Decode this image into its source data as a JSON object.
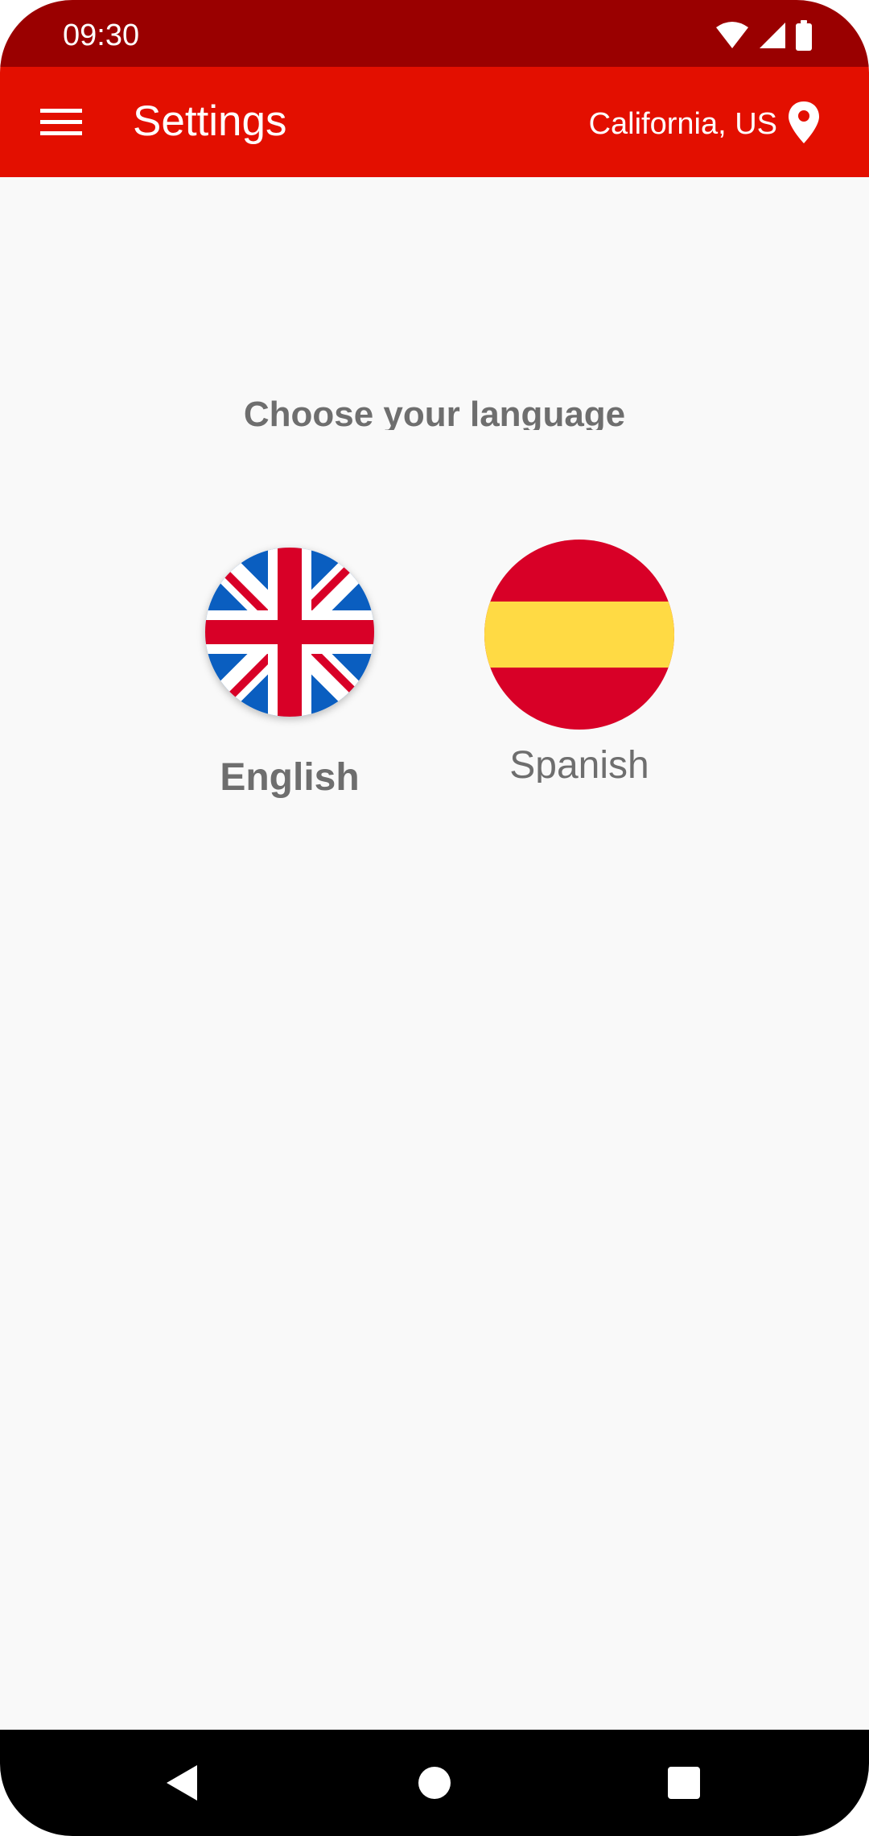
{
  "status_bar": {
    "time": "09:30",
    "icons": [
      "wifi-icon",
      "cell-signal-icon",
      "battery-icon"
    ]
  },
  "app_bar": {
    "menu_icon": "hamburger-menu-icon",
    "title": "Settings",
    "location_text": "California, US",
    "location_icon": "location-pin-icon"
  },
  "main": {
    "heading": "Choose your language",
    "languages": [
      {
        "label": "English",
        "flag": "uk-flag-icon",
        "selected": true
      },
      {
        "label": "Spanish",
        "flag": "spain-flag-icon",
        "selected": false
      }
    ]
  },
  "nav_bar": {
    "buttons": [
      "back-icon",
      "home-icon",
      "recents-icon"
    ]
  },
  "colors": {
    "status_bar": "#9a0000",
    "app_bar": "#e30f00",
    "background": "#f9f9f9",
    "text_gray": "#6e6e6e",
    "uk_blue": "#0a5ec0",
    "uk_red": "#d80027",
    "es_red": "#d80027",
    "es_yellow": "#ffda44"
  }
}
